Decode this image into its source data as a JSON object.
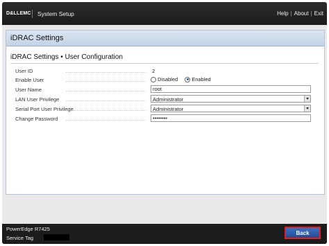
{
  "topbar": {
    "logo": "D&LLEMC",
    "title": "System Setup",
    "links": [
      "Help",
      "About",
      "Exit"
    ],
    "separator": "|"
  },
  "panel": {
    "title": "iDRAC Settings",
    "section_title": "iDRAC Settings • User Configuration"
  },
  "form": {
    "user_id": {
      "label": "User ID",
      "value": "2"
    },
    "enable_user": {
      "label": "Enable User",
      "options": [
        "Disabled",
        "Enabled"
      ],
      "selected": "Enabled"
    },
    "user_name": {
      "label": "User Name",
      "value": "root"
    },
    "lan_privilege": {
      "label": "LAN User Privilege",
      "value": "Administrator"
    },
    "serial_privilege": {
      "label": "Serial Port User Privilege",
      "value": "Administrator"
    },
    "password": {
      "label": "Change Password",
      "value": "••••••••"
    }
  },
  "footer": {
    "model": "PowerEdge R7425",
    "service_tag_label": "Service Tag",
    "back_label": "Back"
  },
  "colors": {
    "accent": "#234b93",
    "highlight": "#e02020"
  }
}
